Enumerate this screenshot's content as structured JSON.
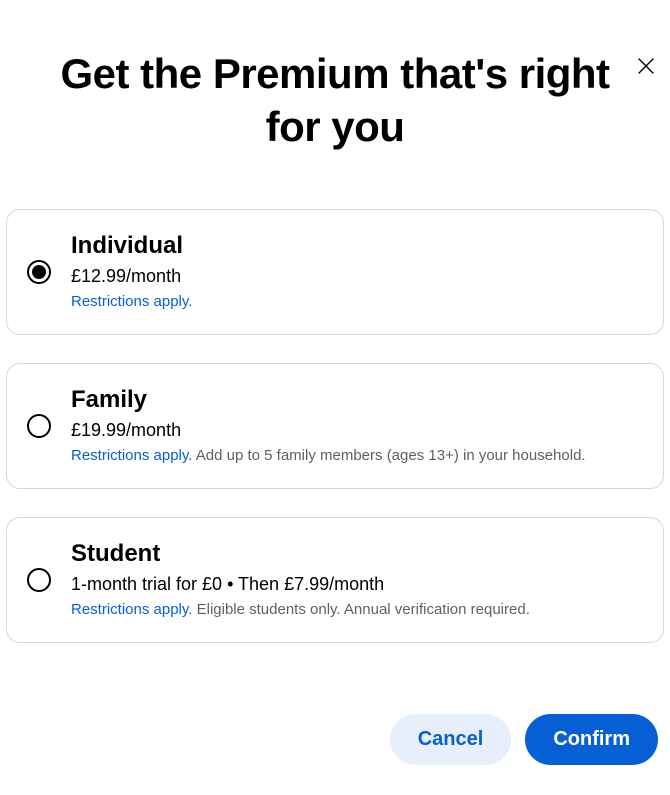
{
  "title": "Get the Premium that's right for you",
  "plans": [
    {
      "name": "Individual",
      "price": "£12.99/month",
      "restrict": "Restrictions apply.",
      "note": "",
      "selected": true
    },
    {
      "name": "Family",
      "price": "£19.99/month",
      "restrict": "Restrictions apply.",
      "note": " Add up to 5 family members (ages 13+) in your household.",
      "selected": false
    },
    {
      "name": "Student",
      "price": "1-month trial for £0 • Then £7.99/month",
      "restrict": "Restrictions apply.",
      "note": " Eligible students only. Annual verification required.",
      "selected": false
    }
  ],
  "buttons": {
    "cancel": "Cancel",
    "confirm": "Confirm"
  }
}
